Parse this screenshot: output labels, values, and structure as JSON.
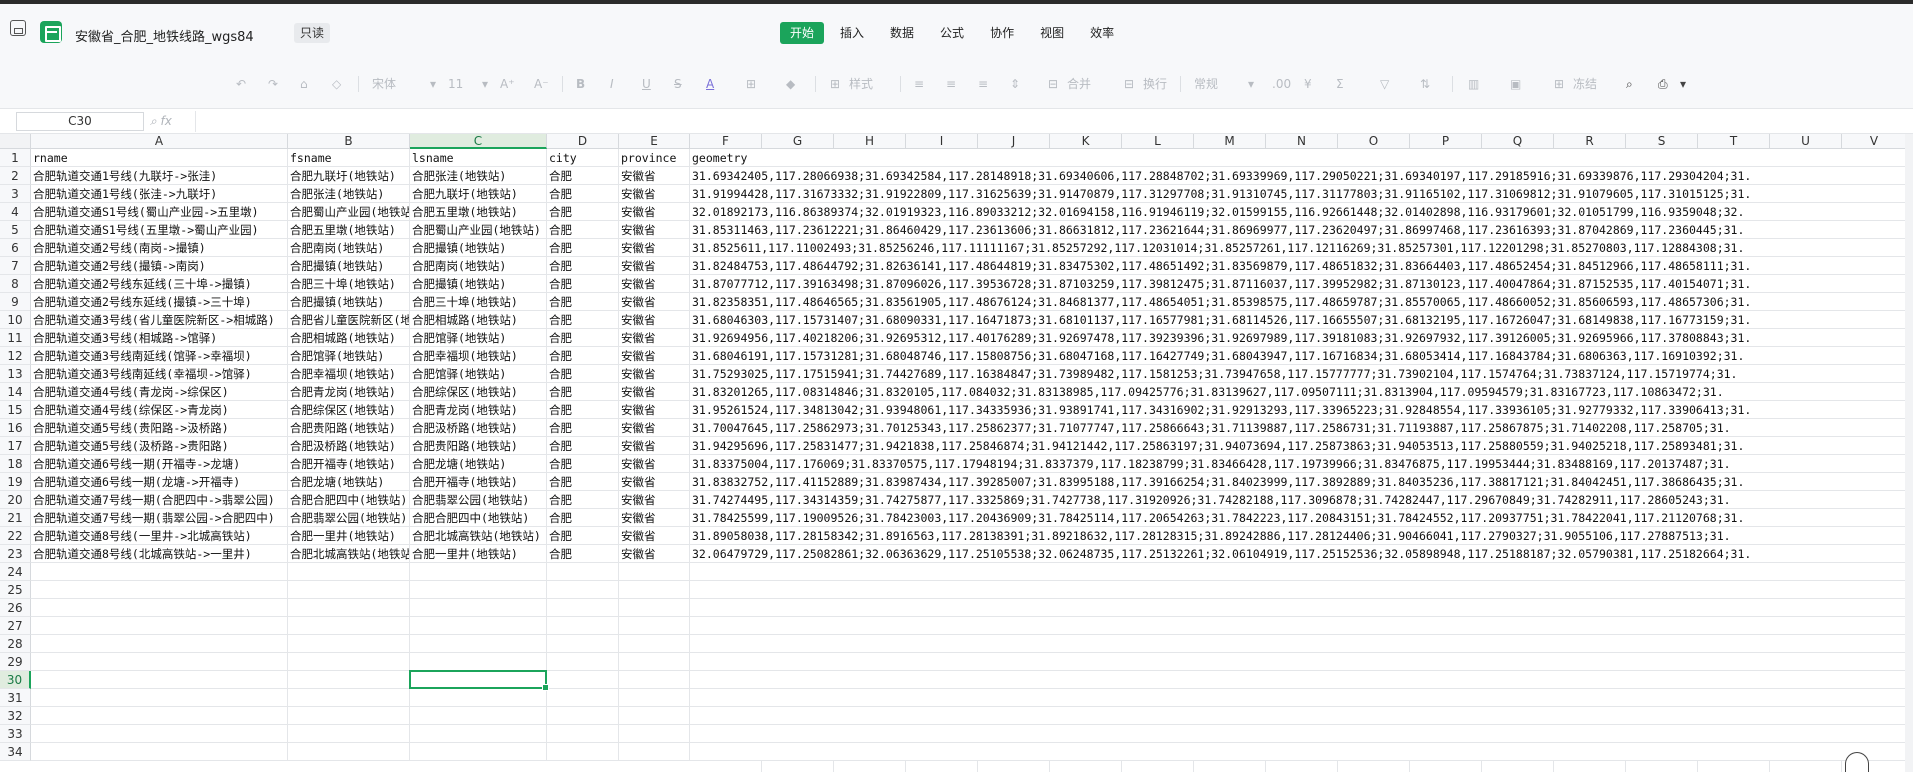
{
  "app": {
    "doc_title": "安徽省_合肥_地铁线路_wgs84",
    "readonly_label": "只读",
    "tabs": [
      {
        "label": "开始",
        "active": true
      },
      {
        "label": "插入",
        "active": false
      },
      {
        "label": "数据",
        "active": false
      },
      {
        "label": "公式",
        "active": false
      },
      {
        "label": "协作",
        "active": false
      },
      {
        "label": "视图",
        "active": false
      },
      {
        "label": "效率",
        "active": false
      }
    ],
    "accent_color": "#1ba45b"
  },
  "toolbar": {
    "font_name": "宋体",
    "font_size": "11",
    "styles_label": "样式",
    "merge_label": "合并",
    "wrap_label": "换行",
    "number_format": "常规",
    "filter_label": "冻结"
  },
  "formula_bar": {
    "name_box": "C30",
    "fx_label": "fx",
    "formula": ""
  },
  "sheet": {
    "columns": [
      "A",
      "B",
      "C",
      "D",
      "E",
      "F",
      "G",
      "H",
      "I",
      "J",
      "K",
      "L",
      "M",
      "N",
      "O",
      "P",
      "Q",
      "R",
      "S",
      "T",
      "U",
      "V"
    ],
    "selected_column": "C",
    "selected_row": 30,
    "row_numbers": [
      "1",
      "2",
      "3",
      "4",
      "5",
      "6",
      "7",
      "8",
      "9",
      "10",
      "11",
      "12",
      "13",
      "14",
      "15",
      "16",
      "17",
      "18",
      "19",
      "20",
      "21",
      "22",
      "23",
      "24",
      "25",
      "26",
      "27",
      "28",
      "29",
      "30",
      "31",
      "32",
      "33",
      "34"
    ],
    "rows": [
      [
        "rname",
        "fsname",
        "lsname",
        "city",
        "province",
        "geometry"
      ],
      [
        "合肥轨道交通1号线(九联圩->张洼)",
        "合肥九联圩(地铁站)",
        "合肥张洼(地铁站)",
        "合肥",
        "安徽省",
        "31.69342405,117.28066938;31.69342584,117.28148918;31.69340606,117.28848702;31.69339969,117.29050221;31.69340197,117.29185916;31.69339876,117.29304204;31."
      ],
      [
        "合肥轨道交通1号线(张洼->九联圩)",
        "合肥张洼(地铁站)",
        "合肥九联圩(地铁站)",
        "合肥",
        "安徽省",
        "31.91994428,117.31673332;31.91922809,117.31625639;31.91470879,117.31297708;31.91310745,117.31177803;31.91165102,117.31069812;31.91079605,117.31015125;31."
      ],
      [
        "合肥轨道交通S1号线(蜀山产业园->五里墩)",
        "合肥蜀山产业园(地铁站)",
        "合肥五里墩(地铁站)",
        "合肥",
        "安徽省",
        "32.01892173,116.86389374;32.01919323,116.89033212;32.01694158,116.91946119;32.01599155,116.92661448;32.01402898,116.93179601;32.01051799,116.9359048;32."
      ],
      [
        "合肥轨道交通S1号线(五里墩->蜀山产业园)",
        "合肥五里墩(地铁站)",
        "合肥蜀山产业园(地铁站)",
        "合肥",
        "安徽省",
        "31.85311463,117.23612221;31.86460429,117.23613606;31.86631812,117.23621644;31.86969977,117.23620497;31.86997468,117.23616393;31.87042869,117.2360445;31."
      ],
      [
        "合肥轨道交通2号线(南岗->撮镇)",
        "合肥南岗(地铁站)",
        "合肥撮镇(地铁站)",
        "合肥",
        "安徽省",
        "31.8525611,117.11002493;31.85256246,117.11111167;31.85257292,117.12031014;31.85257261,117.12116269;31.85257301,117.12201298;31.85270803,117.12884308;31."
      ],
      [
        "合肥轨道交通2号线(撮镇->南岗)",
        "合肥撮镇(地铁站)",
        "合肥南岗(地铁站)",
        "合肥",
        "安徽省",
        "31.82484753,117.48644792;31.82636141,117.48644819;31.83475302,117.48651492;31.83569879,117.48651832;31.83664403,117.48652454;31.84512966,117.48658111;31."
      ],
      [
        "合肥轨道交通2号线东延线(三十埠->撮镇)",
        "合肥三十埠(地铁站)",
        "合肥撮镇(地铁站)",
        "合肥",
        "安徽省",
        "31.87077712,117.39163498;31.87096026,117.39536728;31.87103259,117.39812475;31.87116037,117.39952982;31.87130123,117.40047864;31.87152535,117.40154071;31."
      ],
      [
        "合肥轨道交通2号线东延线(撮镇->三十埠)",
        "合肥撮镇(地铁站)",
        "合肥三十埠(地铁站)",
        "合肥",
        "安徽省",
        "31.82358351,117.48646565;31.83561905,117.48676124;31.84681377,117.48654051;31.85398575,117.48659787;31.85570065,117.48660052;31.85606593,117.48657306;31."
      ],
      [
        "合肥轨道交通3号线(省儿童医院新区->相城路)",
        "合肥省儿童医院新区(地铁站)",
        "合肥相城路(地铁站)",
        "合肥",
        "安徽省",
        "31.68046303,117.15731407;31.68090331,117.16471873;31.68101137,117.16577981;31.68114526,117.16655507;31.68132195,117.16726047;31.68149838,117.16773159;31."
      ],
      [
        "合肥轨道交通3号线(相城路->馆驿)",
        "合肥相城路(地铁站)",
        "合肥馆驿(地铁站)",
        "合肥",
        "安徽省",
        "31.92694956,117.40218206;31.92695312,117.40176289;31.92697478,117.39239396;31.92697989,117.39181083;31.92697932,117.39126005;31.92695966,117.37808843;31."
      ],
      [
        "合肥轨道交通3号线南延线(馆驿->幸福坝)",
        "合肥馆驿(地铁站)",
        "合肥幸福坝(地铁站)",
        "合肥",
        "安徽省",
        "31.68046191,117.15731281;31.68048746,117.15808756;31.68047168,117.16427749;31.68043947,117.16716834;31.68053414,117.16843784;31.6806363,117.16910392;31."
      ],
      [
        "合肥轨道交通3号线南延线(幸福坝->馆驿)",
        "合肥幸福坝(地铁站)",
        "合肥馆驿(地铁站)",
        "合肥",
        "安徽省",
        "31.75293025,117.17515941;31.74427689,117.16384847;31.73989482,117.1581253;31.73947658,117.15777777;31.73902104,117.1574764;31.73837124,117.15719774;31."
      ],
      [
        "合肥轨道交通4号线(青龙岗->综保区)",
        "合肥青龙岗(地铁站)",
        "合肥综保区(地铁站)",
        "合肥",
        "安徽省",
        "31.83201265,117.08314846;31.8320105,117.084032;31.83138985,117.09425776;31.83139627,117.09507111;31.8313904,117.09594579;31.83167723,117.10863472;31."
      ],
      [
        "合肥轨道交通4号线(综保区->青龙岗)",
        "合肥综保区(地铁站)",
        "合肥青龙岗(地铁站)",
        "合肥",
        "安徽省",
        "31.95261524,117.34813042;31.93948061,117.34335936;31.93891741,117.34316902;31.92913293,117.33965223;31.92848554,117.33936105;31.92779332,117.33906413;31."
      ],
      [
        "合肥轨道交通5号线(贵阳路->汲桥路)",
        "合肥贵阳路(地铁站)",
        "合肥汲桥路(地铁站)",
        "合肥",
        "安徽省",
        "31.70047645,117.25862973;31.70125343,117.25862377;31.71077747,117.25866643;31.71139887,117.2586731;31.71193887,117.25867875;31.71402208,117.258705;31."
      ],
      [
        "合肥轨道交通5号线(汲桥路->贵阳路)",
        "合肥汲桥路(地铁站)",
        "合肥贵阳路(地铁站)",
        "合肥",
        "安徽省",
        "31.94295696,117.25831477;31.9421838,117.25846874;31.94121442,117.25863197;31.94073694,117.25873863;31.94053513,117.25880559;31.94025218,117.25893481;31."
      ],
      [
        "合肥轨道交通6号线一期(开福寺->龙塘)",
        "合肥开福寺(地铁站)",
        "合肥龙塘(地铁站)",
        "合肥",
        "安徽省",
        "31.83375004,117.176069;31.83370575,117.17948194;31.8337379,117.18238799;31.83466428,117.19739966;31.83476875,117.19953444;31.83488169,117.20137487;31."
      ],
      [
        "合肥轨道交通6号线一期(龙塘->开福寺)",
        "合肥龙塘(地铁站)",
        "合肥开福寺(地铁站)",
        "合肥",
        "安徽省",
        "31.83832752,117.41152889;31.83987434,117.39285007;31.83995188,117.39166254;31.84023999,117.3892889;31.84035236,117.38817121;31.84042451,117.38686435;31."
      ],
      [
        "合肥轨道交通7号线一期(合肥四中->翡翠公园)",
        "合肥合肥四中(地铁站)",
        "合肥翡翠公园(地铁站)",
        "合肥",
        "安徽省",
        "31.74274495,117.34314359;31.74275877,117.3325869;31.7427738,117.31920926;31.74282188,117.3096878;31.74282447,117.29670849;31.74282911,117.28605243;31."
      ],
      [
        "合肥轨道交通7号线一期(翡翠公园->合肥四中)",
        "合肥翡翠公园(地铁站)",
        "合肥合肥四中(地铁站)",
        "合肥",
        "安徽省",
        "31.78425599,117.19009526;31.78423003,117.20436909;31.78425114,117.20654263;31.7842223,117.20843151;31.78424552,117.20937751;31.78422041,117.21120768;31."
      ],
      [
        "合肥轨道交通8号线(一里井->北城高铁站)",
        "合肥一里井(地铁站)",
        "合肥北城高铁站(地铁站)",
        "合肥",
        "安徽省",
        "31.89058038,117.28158342;31.8916563,117.28138391;31.89218632,117.28128315;31.89242886,117.28124406;31.90466041,117.2790327;31.9055106,117.27887513;31."
      ],
      [
        "合肥轨道交通8号线(北城高铁站->一里井)",
        "合肥北城高铁站(地铁站)",
        "合肥一里井(地铁站)",
        "合肥",
        "安徽省",
        "32.06479729,117.25082861;32.06363629,117.25105538;32.06248735,117.25132261;32.06104919,117.25152536;32.05898948,117.25188187;32.05790381,117.25182664;31."
      ]
    ]
  }
}
